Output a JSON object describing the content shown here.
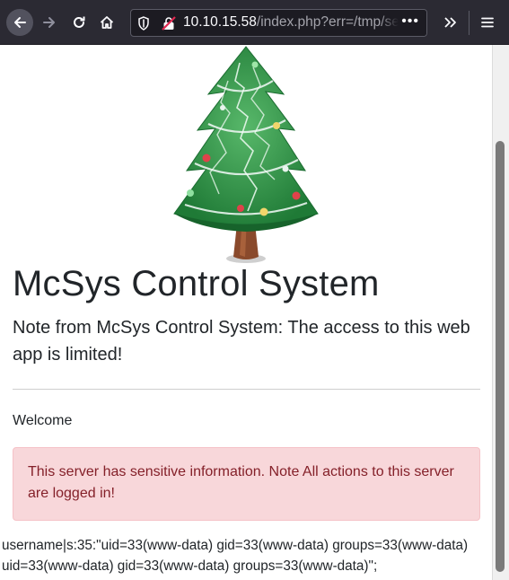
{
  "browser": {
    "url_host": "10.10.15.58",
    "url_path": "/index.php?err=/tmp/se",
    "url_more": "•••",
    "icons": {
      "back": "back-arrow-icon",
      "forward": "forward-arrow-icon",
      "reload": "reload-icon",
      "home": "home-icon",
      "shield": "tracking-protection-shield-icon",
      "insecure": "insecure-lock-icon",
      "overflow": "chevron-double-right-icon",
      "menu": "hamburger-menu-icon"
    }
  },
  "page": {
    "title": "McSys Control System",
    "subtitle": "Note from McSys Control System: The access to this web app is limited!",
    "welcome": "Welcome",
    "alert": "This server has sensitive information. Note All actions to this server are logged in!",
    "session_dump": "username|s:35:\"uid=33(www-data) gid=33(www-data) groups=33(www-data)\nuid=33(www-data) gid=33(www-data) groups=33(www-data)\";",
    "alert_colors": {
      "background": "#f8d7da",
      "text": "#842029"
    }
  }
}
